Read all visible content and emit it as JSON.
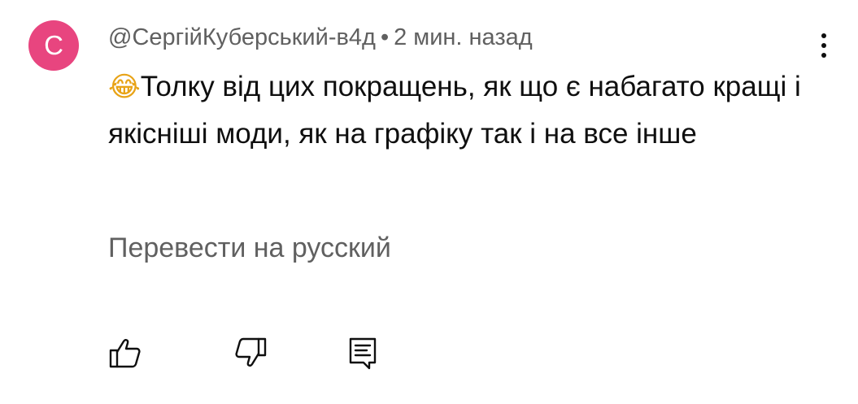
{
  "comment": {
    "avatar_letter": "C",
    "avatar_color": "#e8457f",
    "author": "@СергійКуберський-в4д",
    "separator": "•",
    "time": "2 мин. назад",
    "emoji": "😂",
    "text": "Толку від цих покращень, як що є набагато кращі і якісніші моди, як на графіку так і на все інше",
    "translate_label": "Перевести на русский"
  },
  "icons": {
    "menu": "more-vertical-icon",
    "like": "thumbs-up-icon",
    "dislike": "thumbs-down-icon",
    "reply": "reply-comment-icon"
  }
}
